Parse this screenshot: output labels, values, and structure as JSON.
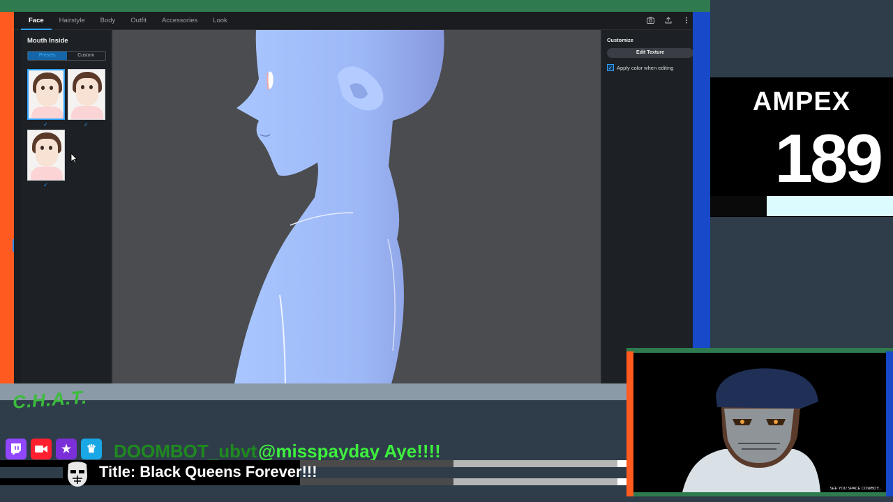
{
  "app": {
    "tabs": [
      {
        "label": "Face",
        "active": true
      },
      {
        "label": "Hairstyle",
        "active": false
      },
      {
        "label": "Body",
        "active": false
      },
      {
        "label": "Outfit",
        "active": false
      },
      {
        "label": "Accessories",
        "active": false
      },
      {
        "label": "Look",
        "active": false
      }
    ],
    "toolbar_icons": [
      "camera-icon",
      "upload-icon",
      "more-vertical-icon"
    ],
    "left_panel": {
      "title": "Mouth Inside",
      "segment": {
        "presets": "Presets",
        "custom": "Custom",
        "selected": "Presets"
      },
      "presets": [
        {
          "id": "preset-1",
          "selected": true
        },
        {
          "id": "preset-2",
          "selected": false
        },
        {
          "id": "preset-3",
          "selected": false
        }
      ]
    },
    "right_panel": {
      "title": "Customize",
      "edit_texture": "Edit Texture",
      "apply_color": "Apply color when editing",
      "apply_color_checked": true
    }
  },
  "overlay": {
    "brand": "AMPEX",
    "number": "189",
    "meter_fraction": 0.69,
    "chat_logo": "C.H.A.T.",
    "chat_user": "DOOMBOT_ubvt",
    "chat_message": "@misspayday Aye!!!!",
    "social_icons": [
      "twitch-icon",
      "camera-record-icon",
      "star-icon",
      "crown-icon"
    ],
    "stream_title": "Title: Black Queens Forever!!!",
    "cam_caption": "SEE YOU SPACE COWBOY..."
  },
  "colors": {
    "accent": "#2ea1ff",
    "orange": "#ff5a1f",
    "green": "#2f7a4e",
    "blue": "#1749c9",
    "chat_green": "#3ef03e"
  }
}
